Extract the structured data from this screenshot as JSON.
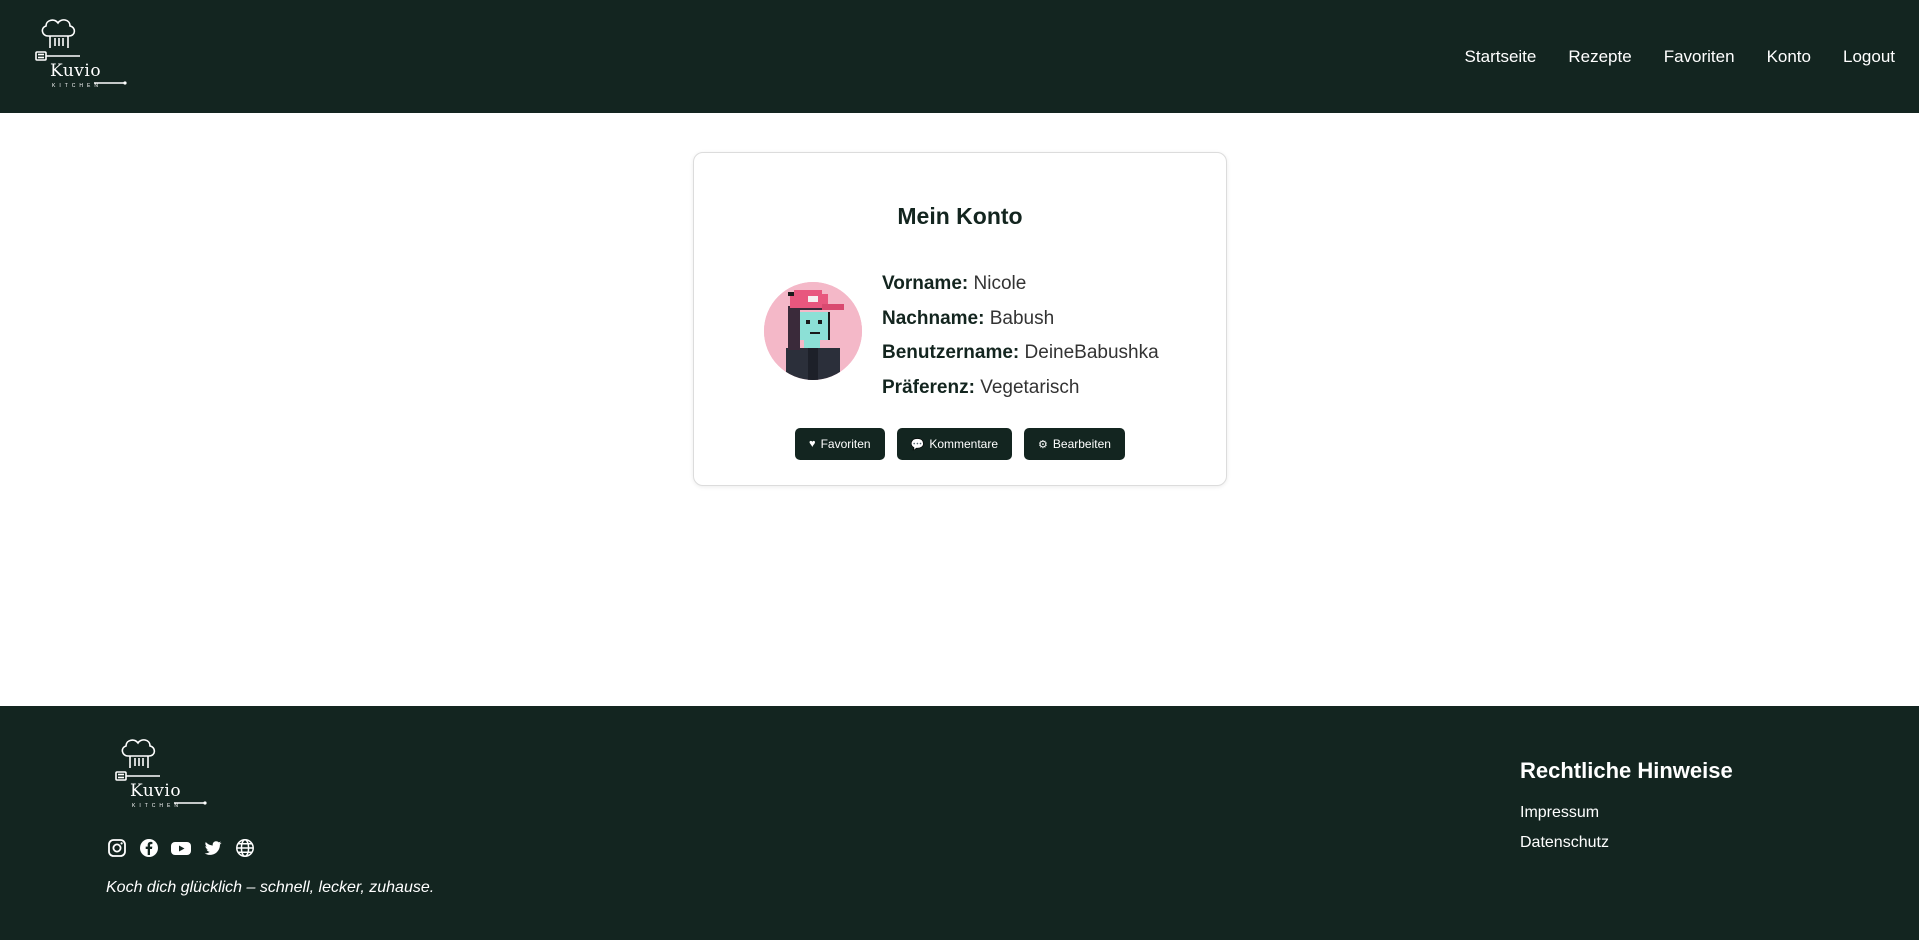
{
  "header": {
    "logo": {
      "word": "Kuvio",
      "sub": "KITCHEN"
    },
    "nav": [
      "Startseite",
      "Rezepte",
      "Favoriten",
      "Konto",
      "Logout"
    ]
  },
  "account": {
    "title": "Mein Konto",
    "fields": [
      {
        "label": "Vorname:",
        "value": "Nicole"
      },
      {
        "label": "Nachname:",
        "value": "Babush"
      },
      {
        "label": "Benutzername:",
        "value": "DeineBabushka"
      },
      {
        "label": "Präferenz:",
        "value": "Vegetarisch"
      }
    ],
    "buttons": [
      {
        "icon": "♥",
        "label": "Favoriten"
      },
      {
        "icon": "💬",
        "label": "Kommentare"
      },
      {
        "icon": "⚙",
        "label": "Bearbeiten"
      }
    ]
  },
  "footer": {
    "logo": {
      "word": "Kuvio",
      "sub": "KITCHEN"
    },
    "socials": [
      "instagram-icon",
      "facebook-icon",
      "youtube-icon",
      "twitter-icon",
      "globe-icon"
    ],
    "tagline": "Koch dich glücklich – schnell, lecker, zuhause.",
    "legal_title": "Rechtliche Hinweise",
    "legal_links": [
      "Impressum",
      "Datenschutz"
    ]
  },
  "colors": {
    "primary": "#132520",
    "avatar_bg": "#f4b8c8"
  }
}
